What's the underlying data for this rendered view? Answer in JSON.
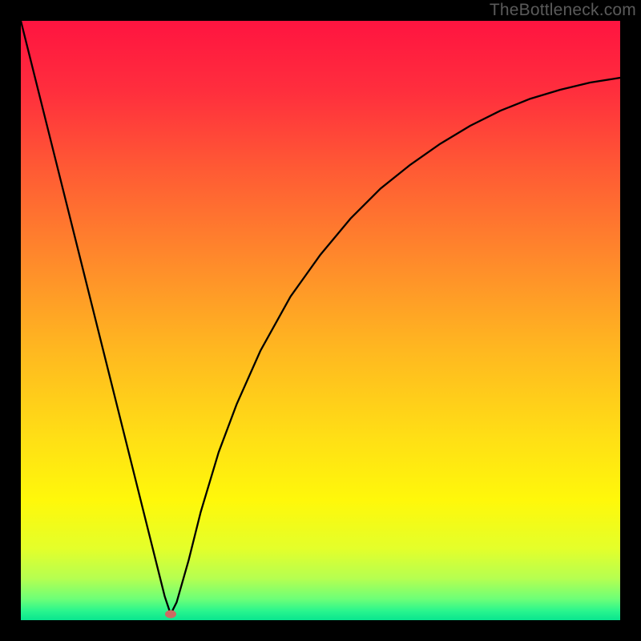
{
  "watermark": "TheBottleneck.com",
  "chart_data": {
    "type": "line",
    "title": "",
    "xlabel": "",
    "ylabel": "",
    "xlim": [
      0,
      100
    ],
    "ylim": [
      0,
      100
    ],
    "series": [
      {
        "name": "bottleneck-curve",
        "x": [
          0,
          5,
          10,
          15,
          20,
          23,
          24,
          25,
          26,
          28,
          30,
          33,
          36,
          40,
          45,
          50,
          55,
          60,
          65,
          70,
          75,
          80,
          85,
          90,
          95,
          100
        ],
        "y": [
          100,
          80,
          60,
          40,
          20,
          8,
          4,
          1,
          3,
          10,
          18,
          28,
          36,
          45,
          54,
          61,
          67,
          72,
          76,
          79.5,
          82.5,
          85,
          87,
          88.5,
          89.7,
          90.5
        ]
      }
    ],
    "marker": {
      "x": 25,
      "y": 1,
      "color": "#cd6a62"
    },
    "gradient_stops": [
      {
        "offset": 0.0,
        "color": "#ff1440"
      },
      {
        "offset": 0.12,
        "color": "#ff2f3d"
      },
      {
        "offset": 0.25,
        "color": "#ff5b34"
      },
      {
        "offset": 0.4,
        "color": "#ff8a2b"
      },
      {
        "offset": 0.55,
        "color": "#ffb820"
      },
      {
        "offset": 0.7,
        "color": "#ffe015"
      },
      {
        "offset": 0.8,
        "color": "#fff80a"
      },
      {
        "offset": 0.88,
        "color": "#e4ff2a"
      },
      {
        "offset": 0.93,
        "color": "#b6ff50"
      },
      {
        "offset": 0.965,
        "color": "#6cff78"
      },
      {
        "offset": 0.985,
        "color": "#28f58e"
      },
      {
        "offset": 1.0,
        "color": "#09e58f"
      }
    ]
  }
}
